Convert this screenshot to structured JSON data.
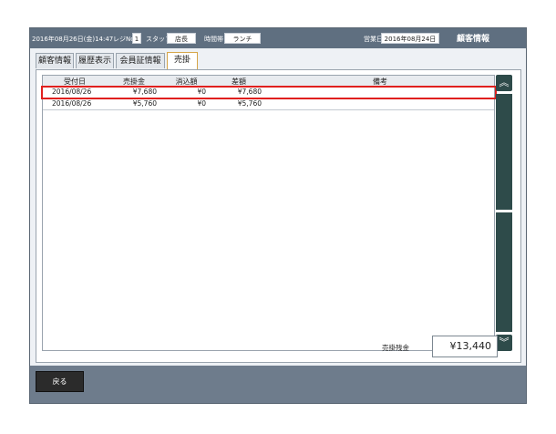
{
  "header": {
    "datetime": "2016年08月26日(金)14:47",
    "register_label": "レジNo",
    "register_no": "1",
    "staff_label": "スタッフ",
    "staff_value": "店長",
    "time_label": "時間帯",
    "time_value": "ランチ",
    "business_day_label": "営業日",
    "business_day_value": "2016年08月24日",
    "title": "顧客情報"
  },
  "tabs": [
    "顧客情報",
    "履歴表示",
    "会員証情報",
    "売掛"
  ],
  "table": {
    "columns": [
      "受付日",
      "売掛金",
      "消込額",
      "差額",
      "備考"
    ],
    "rows": [
      {
        "date": "2016/08/26",
        "amount": "¥7,680",
        "cleared": "¥0",
        "diff": "¥7,680",
        "note": ""
      },
      {
        "date": "2016/08/26",
        "amount": "¥5,760",
        "cleared": "¥0",
        "diff": "¥5,760",
        "note": ""
      }
    ]
  },
  "scroll": {
    "up_icon": "double-chevron-up",
    "down_icon": "double-chevron-down",
    "up_glyph": "︽",
    "down_glyph": "︾"
  },
  "total": {
    "label": "売掛残金",
    "value": "¥13,440"
  },
  "footer": {
    "back_label": "戻る"
  }
}
